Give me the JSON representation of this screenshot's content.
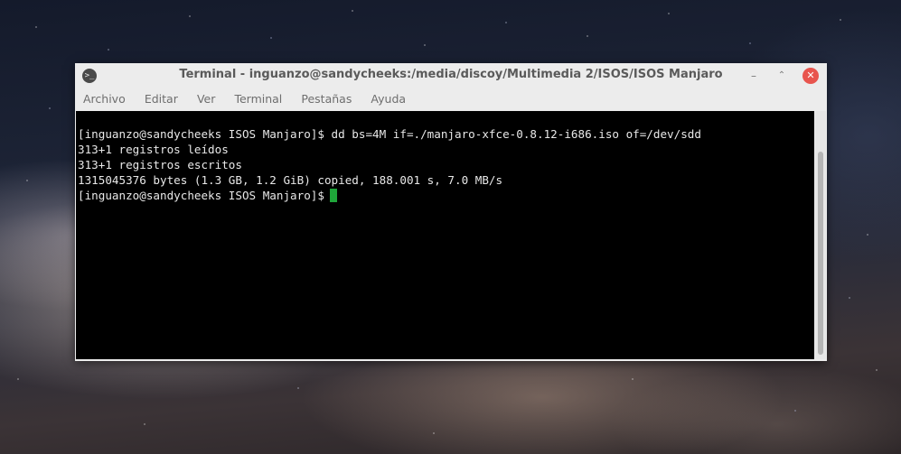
{
  "window": {
    "title": "Terminal - inguanzo@sandycheeks:/media/discoy/Multimedia 2/ISOS/ISOS Manjaro",
    "app_icon": "terminal-icon",
    "controls": {
      "minimize": "–",
      "maximize": "⌃",
      "close": "✕"
    }
  },
  "menubar": {
    "items": [
      "Archivo",
      "Editar",
      "Ver",
      "Terminal",
      "Pestañas",
      "Ayuda"
    ]
  },
  "terminal": {
    "lines": [
      "[inguanzo@sandycheeks ISOS Manjaro]$ dd bs=4M if=./manjaro-xfce-0.8.12-i686.iso of=/dev/sdd",
      "313+1 registros leídos",
      "313+1 registros escritos",
      "1315045376 bytes (1.3 GB, 1.2 GiB) copied, 188.001 s, 7.0 MB/s"
    ],
    "prompt": "[inguanzo@sandycheeks ISOS Manjaro]$",
    "cursor_color": "#1fa53a",
    "background_color": "#000000",
    "text_color": "#e8e8e8"
  },
  "colors": {
    "close_button": "#e8554e",
    "titlebar": "#ececec"
  }
}
